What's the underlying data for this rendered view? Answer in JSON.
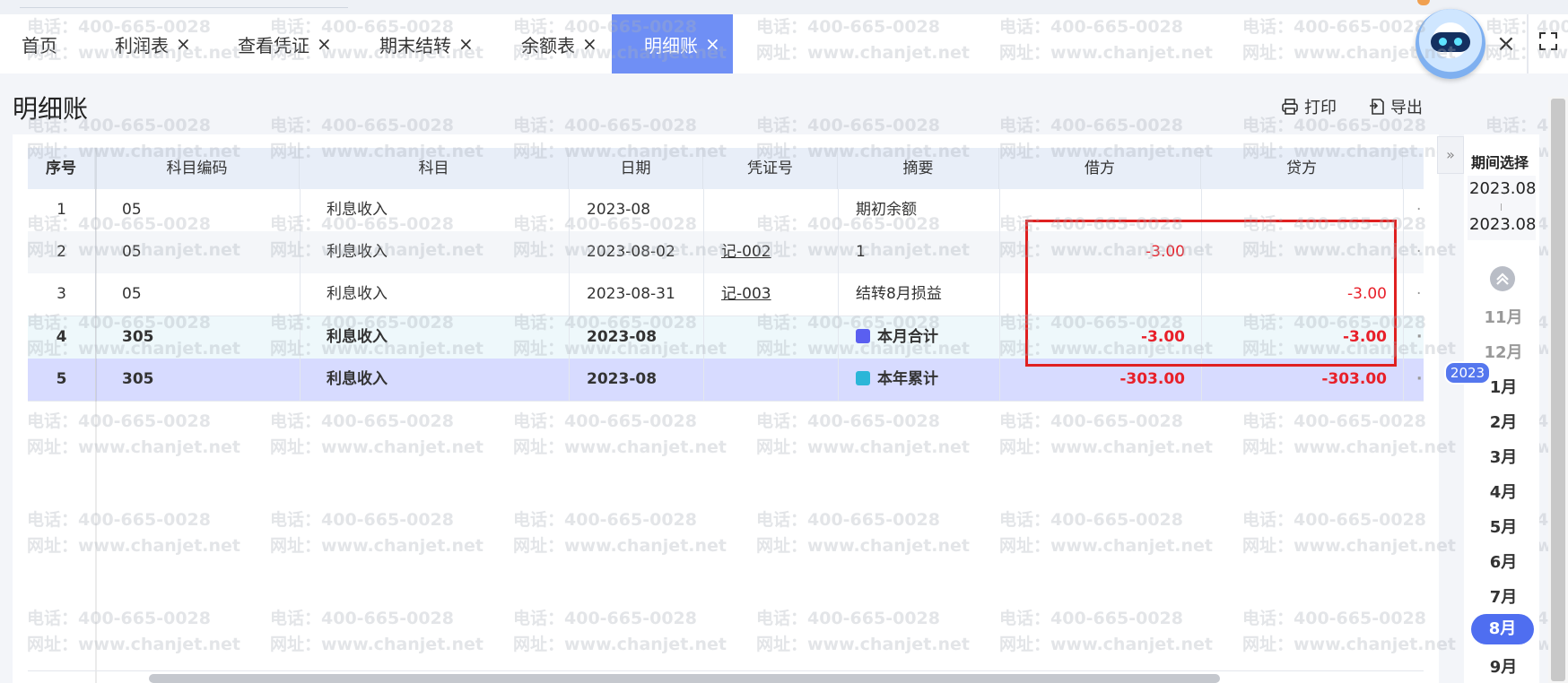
{
  "tabs": [
    {
      "label": "首页",
      "closable": false
    },
    {
      "label": "利润表",
      "closable": true
    },
    {
      "label": "查看凭证",
      "closable": true
    },
    {
      "label": "期末结转",
      "closable": true
    },
    {
      "label": "余额表",
      "closable": true
    },
    {
      "label": "明细账",
      "closable": true,
      "active": true
    }
  ],
  "close_glyph": "×",
  "page": {
    "title": "明细账",
    "print_label": "打印",
    "export_label": "导出"
  },
  "table": {
    "headers": [
      "序号",
      "科目编码",
      "科目",
      "日期",
      "凭证号",
      "摘要",
      "借方",
      "贷方"
    ],
    "rows": [
      {
        "no": "1",
        "code": "05",
        "account": "利息收入",
        "date": "2023-08",
        "voucher": "",
        "summary": "期初余额",
        "debit": "",
        "credit": "",
        "bold": false,
        "summary_icon": ""
      },
      {
        "no": "2",
        "code": "05",
        "account": "利息收入",
        "date": "2023-08-02",
        "voucher": "记-002",
        "summary": "1",
        "debit": "-3.00",
        "credit": "",
        "bold": false,
        "summary_icon": ""
      },
      {
        "no": "3",
        "code": "05",
        "account": "利息收入",
        "date": "2023-08-31",
        "voucher": "记-003",
        "summary": "结转8月损益",
        "debit": "",
        "credit": "-3.00",
        "bold": false,
        "summary_icon": ""
      },
      {
        "no": "4",
        "code": "305",
        "account": "利息收入",
        "date": "2023-08",
        "voucher": "",
        "summary": "本月合计",
        "debit": "-3.00",
        "credit": "-3.00",
        "bold": true,
        "summary_icon": "month-icon"
      },
      {
        "no": "5",
        "code": "305",
        "account": "利息收入",
        "date": "2023-08",
        "voucher": "",
        "summary": "本年累计",
        "debit": "-303.00",
        "credit": "-303.00",
        "bold": true,
        "summary_icon": "year-icon"
      }
    ]
  },
  "watermark": {
    "line1": "电话：400-665-0028",
    "line2": "网址：www.chanjet.net"
  },
  "period": {
    "title": "期间选择",
    "start": "2023.08",
    "end": "2023.08",
    "year_badge": "2023",
    "months": [
      "11月",
      "12月",
      "1月",
      "2月",
      "3月",
      "4月",
      "5月",
      "6月",
      "7月",
      "8月",
      "9月"
    ],
    "prev_year_months": [
      "11月",
      "12月"
    ],
    "active_month": "8月"
  },
  "colors": {
    "accent": "#6f8ff5",
    "negative": "#e8202a",
    "highlight_border": "#e02020",
    "month_active": "#4f6ef0"
  },
  "icons": [
    "close-icon",
    "robot-assistant-icon",
    "fullscreen-icon",
    "printer-icon",
    "export-icon",
    "expand-panel-icon",
    "scroll-up-icon",
    "month-icon",
    "year-icon"
  ]
}
